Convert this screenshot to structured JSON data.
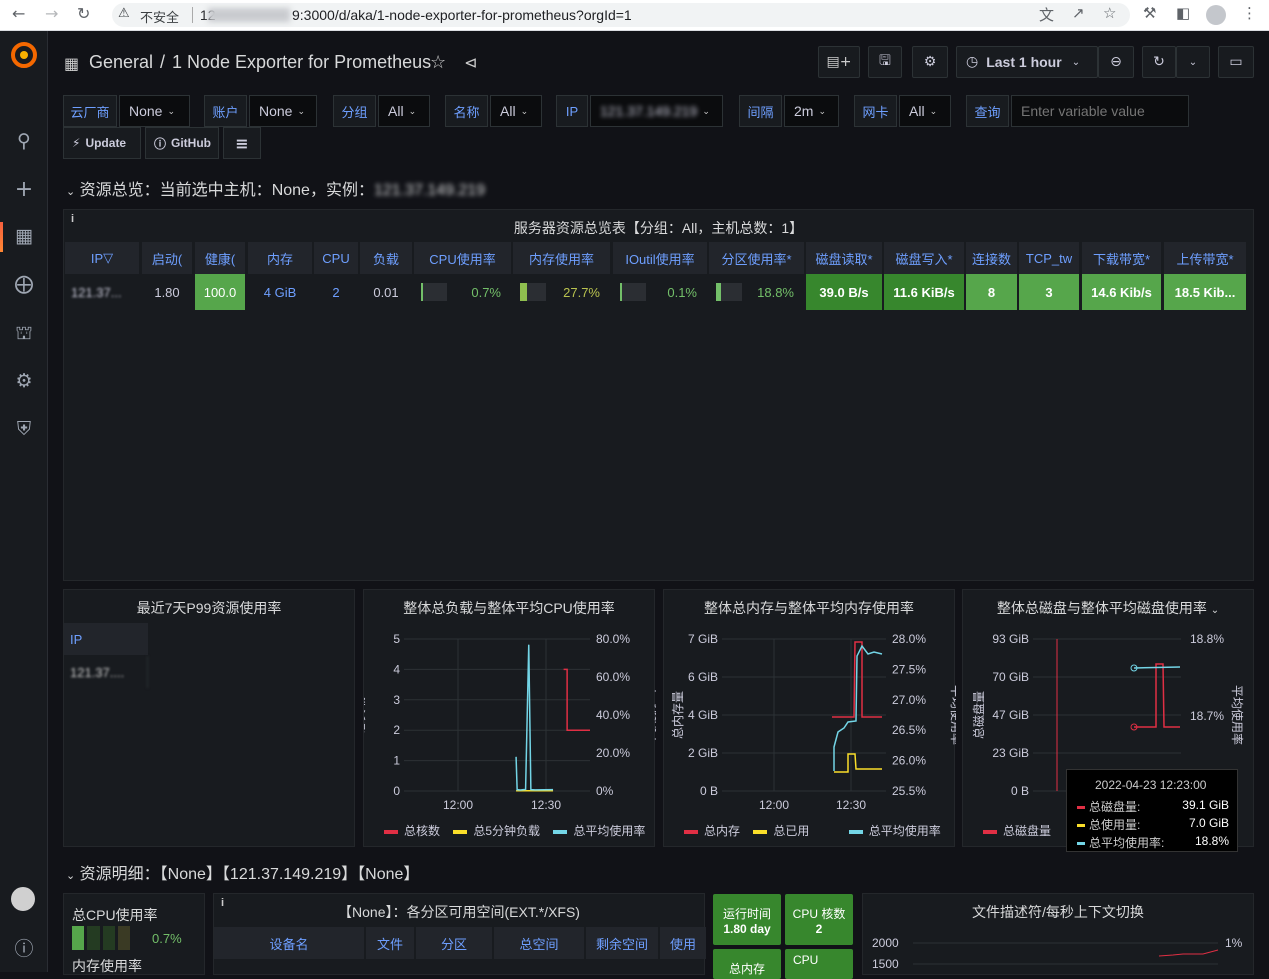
{
  "browser": {
    "insecure_label": "不安全",
    "url_prefix": "12",
    "url_tail": "9:3000/d/aka/1-node-exporter-for-prometheus?orgId=1"
  },
  "header": {
    "breadcrumb_root": "General",
    "breadcrumb_sep": "/",
    "dashboard_title": "1 Node Exporter for Prometheus",
    "time_range": "Last 1 hour"
  },
  "variables": [
    {
      "label": "云厂商",
      "value": "None"
    },
    {
      "label": "账户",
      "value": "None"
    },
    {
      "label": "分组",
      "value": "All"
    },
    {
      "label": "名称",
      "value": "All"
    },
    {
      "label": "IP",
      "value": "121.37.149.219"
    },
    {
      "label": "间隔",
      "value": "2m"
    },
    {
      "label": "网卡",
      "value": "All"
    },
    {
      "label": "查询",
      "placeholder": "Enter variable value"
    }
  ],
  "links": {
    "update": "Update",
    "github": "GitHub"
  },
  "row1": {
    "title_prefix": "资源总览：当前选中主机：",
    "host": "None",
    "instance_prefix": "，实例：",
    "instance": "121.37.149.219"
  },
  "overview_table": {
    "title": "服务器资源总览表【分组：All，主机总数：1】",
    "headers": [
      "IP",
      "启动(",
      "健康(",
      "内存",
      "CPU",
      "负载",
      "CPU使用率",
      "内存使用率",
      "IOutil使用率",
      "分区使用率*",
      "磁盘读取*",
      "磁盘写入*",
      "连接数",
      "TCP_tw",
      "下载带宽*",
      "上传带宽*"
    ],
    "row": {
      "ip": "121.37...",
      "uptime": "1.80",
      "health": "100.0",
      "memory": "4 GiB",
      "cpu": "2",
      "load": "0.01",
      "cpu_usage": "0.7%",
      "mem_usage": "27.7%",
      "ioutil": "0.1%",
      "partition": "18.8%",
      "disk_read": "39.0 B/s",
      "disk_write": "11.6 KiB/s",
      "connections": "8",
      "tcp_tw": "3",
      "download": "14.6 Kib/s",
      "upload": "18.5 Kib..."
    },
    "gauges": {
      "cpu_usage": 0.7,
      "mem_usage": 27.7,
      "ioutil": 0.1,
      "partition": 18.8
    }
  },
  "p99_panel": {
    "title": "最近7天P99资源使用率",
    "col": "IP",
    "cell": "121.37...."
  },
  "chart_titles": {
    "load": "整体总负载与整体平均CPU使用率",
    "mem": "整体总内存与整体平均内存使用率",
    "disk": "整体总磁盘与整体平均磁盘使用率"
  },
  "chart_labels": {
    "load_left": "总负载",
    "load_right": "平均使用率",
    "mem_left": "总内存量",
    "mem_right": "平均使用率",
    "disk_left": "总磁盘量",
    "disk_right": "平均使用率"
  },
  "chart_data": [
    {
      "type": "line",
      "title": "整体总负载与整体平均CPU使用率",
      "x_ticks": [
        "12:00",
        "12:30"
      ],
      "y_left_ticks": [
        "5",
        "4",
        "3",
        "2",
        "1",
        "0"
      ],
      "y_right_ticks": [
        "80.0%",
        "60.0%",
        "40.0%",
        "20.0%",
        "0%"
      ],
      "ylim_left": [
        0,
        5
      ],
      "ylim_right": [
        0,
        80
      ],
      "series": [
        {
          "name": "总核数",
          "color": "#e02f44",
          "axis": "left",
          "x": [
            12.8,
            12.82,
            12.82,
            12.9
          ],
          "y": [
            2,
            2,
            4,
            2
          ]
        },
        {
          "name": "总5分钟负载",
          "color": "#fade2a",
          "axis": "left",
          "x": [
            12.55,
            12.9
          ],
          "y": [
            0.01,
            0.01
          ]
        },
        {
          "name": "总平均使用率",
          "color": "#73d5e6",
          "axis": "right",
          "x": [
            12.55,
            12.56,
            12.59,
            12.62,
            12.64,
            12.67,
            12.69,
            12.73,
            12.9
          ],
          "y": [
            18,
            0.7,
            0.5,
            0.7,
            0.8,
            77,
            0.7,
            0.6,
            0.7
          ]
        }
      ]
    },
    {
      "type": "line",
      "title": "整体总内存与整体平均内存使用率",
      "x_ticks": [
        "12:00",
        "12:30"
      ],
      "y_left_ticks": [
        "7 GiB",
        "6 GiB",
        "4 GiB",
        "2 GiB",
        "0 B"
      ],
      "y_right_ticks": [
        "28.0%",
        "27.5%",
        "27.0%",
        "26.5%",
        "26.0%",
        "25.5%"
      ],
      "series": [
        {
          "name": "总内存",
          "color": "#e02f44",
          "axis": "left"
        },
        {
          "name": "总已用",
          "color": "#fade2a",
          "axis": "left"
        },
        {
          "name": "总平均使用率",
          "color": "#73d5e6",
          "axis": "right",
          "y": [
            25.95,
            26.6,
            26.65,
            26.7,
            27.3,
            27.8,
            27.7
          ]
        }
      ]
    },
    {
      "type": "line",
      "title": "整体总磁盘与整体平均磁盘使用率",
      "y_left_ticks": [
        "93 GiB",
        "70 GiB",
        "47 GiB",
        "23 GiB",
        "0 B"
      ],
      "y_right_ticks": [
        "18.8%",
        "18.7%"
      ],
      "series": [
        {
          "name": "总磁盘量",
          "color": "#e02f44",
          "axis": "left"
        },
        {
          "name": "总使用量",
          "color": "#fade2a",
          "axis": "left"
        },
        {
          "name": "总平均使用率",
          "color": "#73d5e6",
          "axis": "right"
        }
      ]
    }
  ],
  "tooltip": {
    "time": "2022-04-23 12:23:00",
    "items": [
      {
        "name": "总磁盘量:",
        "value": "39.1 GiB",
        "color": "#e02f44"
      },
      {
        "name": "总使用量:",
        "value": "7.0 GiB",
        "color": "#fade2a"
      },
      {
        "name": "总平均使用率:",
        "value": "18.8%",
        "color": "#73d5e6"
      }
    ]
  },
  "row2": {
    "title": "资源明细：【None】【121.37.149.219】【None】"
  },
  "bottom": {
    "cpu_total_label": "总CPU使用率",
    "cpu_total_value": "0.7%",
    "mem_label": "内存使用率",
    "partition_title": "【None】：各分区可用空间(EXT.*/XFS)",
    "partition_headers": [
      "设备名",
      "文件",
      "分区",
      "总空间",
      "剩余空间",
      "使用"
    ],
    "uptime_label": "运行时间",
    "uptime_value": "1.80 day",
    "cpu_cores_label": "CPU 核数",
    "cpu_cores_value": "2",
    "total_mem_label": "总内存",
    "cpu_bottom_label": "CPU",
    "fd_title": "文件描述符/每秒上下文切换",
    "fd_left_ticks": [
      "2000",
      "1500"
    ],
    "fd_right_tick": "1%"
  }
}
